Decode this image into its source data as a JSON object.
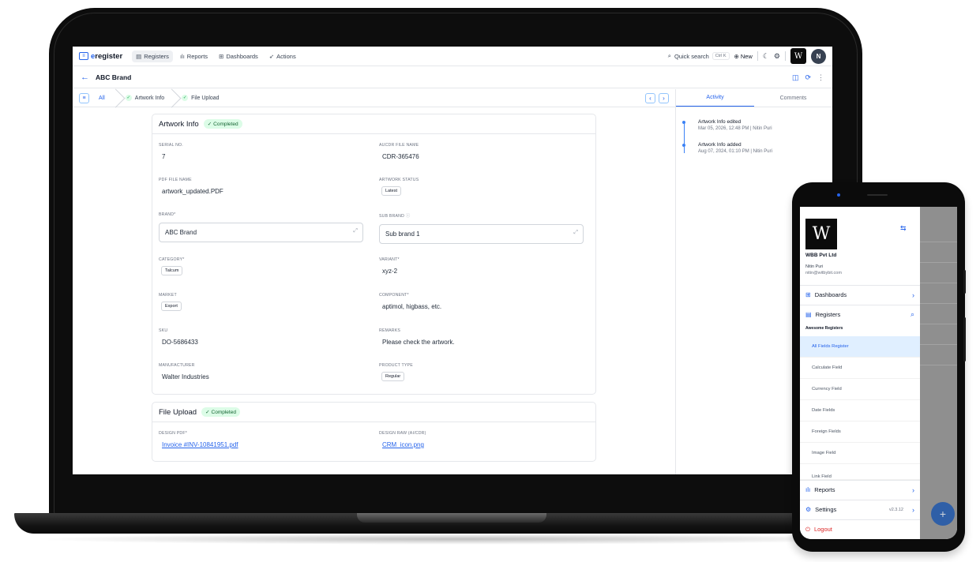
{
  "app": {
    "logo_text": "eregister",
    "nav": [
      {
        "label": "Registers",
        "icon": "register-icon"
      },
      {
        "label": "Reports",
        "icon": "bar-chart-icon"
      },
      {
        "label": "Dashboards",
        "icon": "dashboard-grid-icon"
      },
      {
        "label": "Actions",
        "icon": "rocket-icon"
      }
    ],
    "quick_search": {
      "label": "Quick search",
      "shortcut": "Ctrl K"
    },
    "new_label": "New",
    "avatar_initial": "N",
    "brand_logo_glyph": "W"
  },
  "page": {
    "title": "ABC Brand"
  },
  "steps": [
    {
      "label": "All"
    },
    {
      "label": "Artwork Info"
    },
    {
      "label": "File Upload"
    }
  ],
  "artwork": {
    "title": "Artwork Info",
    "status": "Completed",
    "serial_no": {
      "label": "SERIAL NO.",
      "value": "7"
    },
    "aucdr_file": {
      "label": "AUCDR FILE NAME",
      "value": "CDR-365476"
    },
    "pdf_file": {
      "label": "PDF FILE NAME",
      "value": "artwork_updated.PDF"
    },
    "artwork_status": {
      "label": "ARTWORK STATUS",
      "value": "Latest"
    },
    "brand": {
      "label": "BRAND*",
      "value": "ABC Brand"
    },
    "sub_brand": {
      "label": "SUB BRAND",
      "value": "Sub brand 1"
    },
    "category": {
      "label": "CATEGORY*",
      "value": "Talcum"
    },
    "variant": {
      "label": "VARIANT*",
      "value": "xyz-2"
    },
    "market": {
      "label": "MARKET",
      "value": "Export"
    },
    "component": {
      "label": "COMPONENT*",
      "value": "aptimol, higbass, etc."
    },
    "sku": {
      "label": "SKU",
      "value": "DO-5686433"
    },
    "remarks": {
      "label": "REMARKS",
      "value": "Please check the artwork."
    },
    "manufacturer": {
      "label": "MANUFACTURER",
      "value": "Walter Industries"
    },
    "product_type": {
      "label": "PRODUCT TYPE",
      "value": "Regular"
    }
  },
  "file_upload": {
    "title": "File Upload",
    "status": "Completed",
    "design_pdf": {
      "label": "DESIGN PDF*",
      "value": "Invoice #INV-10841951.pdf"
    },
    "design_raw": {
      "label": "DESIGN RAW (AI/CDR)",
      "value": "CRM_icon.png"
    }
  },
  "side_panel": {
    "tabs": [
      "Activity",
      "Comments"
    ],
    "activity": [
      {
        "title": "Artwork Info edited",
        "date": "Mar 05, 2026, 12:48 PM",
        "user": "Nitin Puri"
      },
      {
        "title": "Artwork Info added",
        "date": "Aug 07, 2024, 01:10 PM",
        "user": "Nitin Puri"
      }
    ]
  },
  "mobile": {
    "org_name": "WBB Pvt Ltd",
    "user_name": "Nitin Puri",
    "user_email": "nitin@witbybit.com",
    "menu": {
      "dashboards": "Dashboards",
      "registers": "Registers",
      "group_label": "Awesome Registers",
      "register_items": [
        "All Fields Register",
        "Calculate Field",
        "Currency Field",
        "Date Fields",
        "Foreign Fields",
        "Image Field",
        "Link Field"
      ],
      "reports": "Reports",
      "settings": "Settings",
      "version": "v2.3.12",
      "logout": "Logout"
    },
    "fab_glyph": "+"
  },
  "colors": {
    "accent": "#2563eb",
    "success_bg": "#dcfce7",
    "success_text": "#166534",
    "danger": "#dc2626"
  }
}
